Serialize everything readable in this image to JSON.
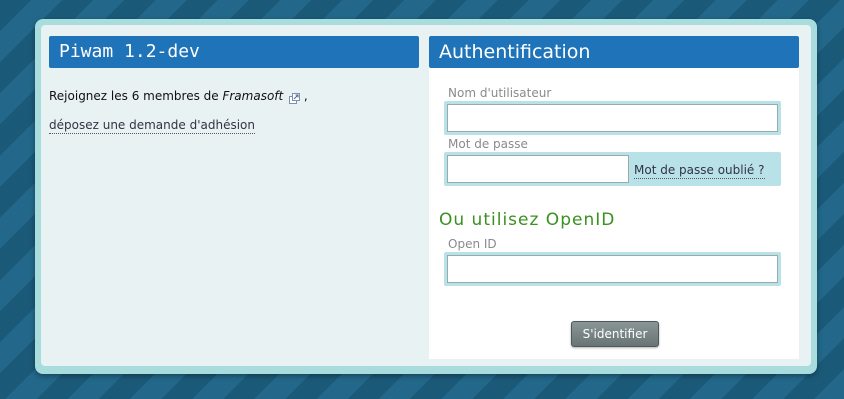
{
  "left_panel": {
    "title": "Piwam 1.2-dev",
    "intro_prefix": "Rejoignez les 6 membres de",
    "org_name": "Framasoft",
    "intro_suffix": ",",
    "join_link": "déposez une demande d'adhésion",
    "external_icon": "external-link-icon"
  },
  "auth_panel": {
    "title": "Authentification",
    "username_label": "Nom d'utilisateur",
    "username_value": "",
    "password_label": "Mot de passe",
    "password_value": "",
    "forgot_password_link": "Mot de passe oublié ?",
    "openid_title": "Ou utilisez OpenID",
    "openid_label": "Open ID",
    "openid_value": "",
    "submit_label": "S'identifier"
  },
  "colors": {
    "header_blue": "#1f73b8",
    "openid_green": "#3a9020",
    "field_highlight": "#b8e2e8",
    "panel_border": "#a9dcdd"
  }
}
